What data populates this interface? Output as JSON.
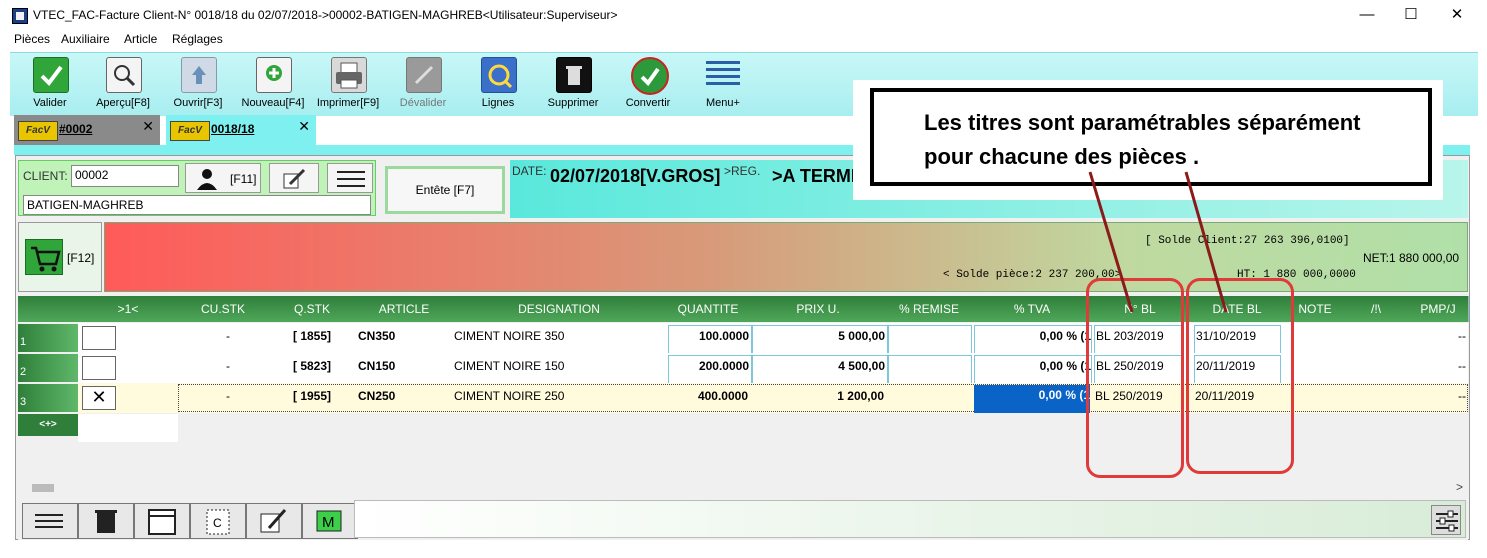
{
  "window": {
    "title": "VTEC_FAC-Facture Client-N° 0018/18 du 02/07/2018->00002-BATIGEN-MAGHREB<Utilisateur:Superviseur>",
    "minimize": "—",
    "maximize": "☐",
    "close": "✕"
  },
  "menu": [
    "Pièces",
    "Auxiliaire",
    "Article",
    "Réglages"
  ],
  "toolbar": [
    {
      "label": "Valider",
      "icon": "check-icon",
      "color": "#2fa53a"
    },
    {
      "label": "Aperçu[F8]",
      "icon": "preview-icon",
      "color": "#f4f4f4"
    },
    {
      "label": "Ouvrir[F3]",
      "icon": "open-icon",
      "color": "#d0dae6"
    },
    {
      "label": "Nouveau[F4]",
      "icon": "new-icon",
      "color": "#f4f4f4"
    },
    {
      "label": "Imprimer[F9]",
      "icon": "printer-icon",
      "color": "#d9d9d9"
    },
    {
      "label": "Dévalider",
      "icon": "devalidate-icon",
      "color": "#9a9a9a"
    },
    {
      "label": "Lignes",
      "icon": "lines-icon",
      "color": "#3a70c9"
    },
    {
      "label": "Supprimer",
      "icon": "trash-icon",
      "color": "#111111"
    },
    {
      "label": "Convertir",
      "icon": "convert-icon",
      "color": "#2c9a3a"
    },
    {
      "label": "Menu+",
      "icon": "menu-plus-icon",
      "color": "#2a5fa8"
    }
  ],
  "tabs": [
    {
      "badge": "FacV",
      "label": "#0002",
      "close": "✕"
    },
    {
      "badge": "FacV",
      "label": "0018/18",
      "close": "✕"
    }
  ],
  "client": {
    "label": "CLIENT:",
    "code": "00002",
    "name": "BATIGEN-MAGHREB",
    "f11": "[F11]"
  },
  "entete_label": "Entête [F7]",
  "info": {
    "date_label": "DATE:",
    "date": "02/07/2018",
    "type": "[V.GROS]",
    "reg_label": ">REG.",
    "reg_value": ">A TERME"
  },
  "totals": {
    "solde_client": "[ Solde Client:27 263 396,0100]",
    "net": "NET:1 880 000,00",
    "solde_piece": "< Solde pièce:2 237 200,00>",
    "ht": "HT:   1 880 000,0000"
  },
  "cart_f12": "[F12]",
  "grid": {
    "headers": [
      ">1<",
      "CU.STK",
      "Q.STK",
      "ARTICLE",
      "DESIGNATION",
      "QUANTITE",
      "PRIX U.",
      "% REMISE",
      "% TVA",
      "N° BL",
      "DATE BL",
      "NOTE",
      "/!\\",
      "PMP/J"
    ],
    "rows": [
      {
        "num": "1",
        "check": "",
        "cu_stk": "-",
        "q_stk": "[ 1855]",
        "article": "CN350",
        "designation": "CIMENT NOIRE 350",
        "quantite": "100.0000",
        "prix": "5 000,00",
        "remise": "",
        "tva": "0,00 % (1",
        "n_bl": "BL 203/2019",
        "date_bl": "31/10/2019",
        "note": "",
        "alert": "",
        "pmp": "--"
      },
      {
        "num": "2",
        "check": "",
        "cu_stk": "-",
        "q_stk": "[ 5823]",
        "article": "CN150",
        "designation": "CIMENT NOIRE 150",
        "quantite": "200.0000",
        "prix": "4 500,00",
        "remise": "",
        "tva": "0,00 % (1",
        "n_bl": "BL 250/2019",
        "date_bl": "20/11/2019",
        "note": "",
        "alert": "",
        "pmp": "--"
      },
      {
        "num": "3",
        "check": "✕",
        "cu_stk": "-",
        "q_stk": "[ 1955]",
        "article": "CN250",
        "designation": "CIMENT NOIRE 250",
        "quantite": "400.0000",
        "prix": "1 200,00",
        "remise": "",
        "tva": "0,00 % (1",
        "n_bl": "BL 250/2019",
        "date_bl": "20/11/2019",
        "note": "",
        "alert": "",
        "pmp": "--"
      }
    ],
    "add_row": "<+>"
  },
  "callout": {
    "line1": "Les titres sont paramétrables séparément",
    "line2": "pour chacune des pièces ."
  },
  "scroll_left": "<",
  "scroll_right": ">",
  "colors": {
    "accent_green": "#2f7f3a",
    "callout_red": "#e03a3a",
    "selected_cell": "#0a64c8"
  }
}
